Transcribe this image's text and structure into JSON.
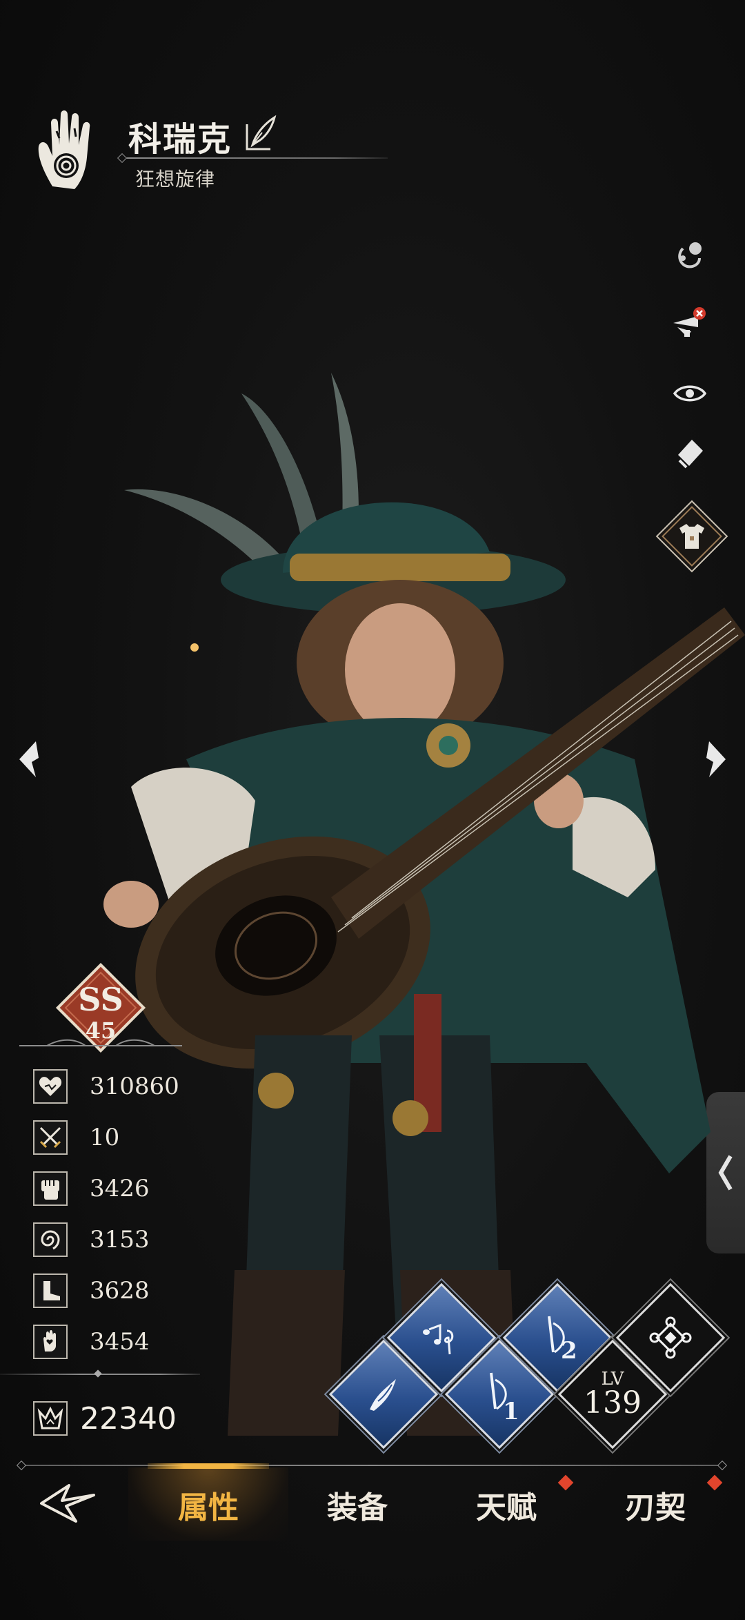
{
  "header": {
    "character_name": "科瑞克",
    "character_title": "狂想旋律",
    "class_icon": "open-hand-sigil-icon",
    "edit_icon": "quill-edit-icon"
  },
  "tools": [
    {
      "name": "pose-icon"
    },
    {
      "name": "hide-weapon-icon"
    },
    {
      "name": "eye-icon"
    },
    {
      "name": "card-icon"
    },
    {
      "name": "costume-shirt-icon"
    }
  ],
  "grade": {
    "rank": "SS",
    "level": "45"
  },
  "stats": [
    {
      "icon": "heart-hp-icon",
      "value": "310860"
    },
    {
      "icon": "crossed-swords-icon",
      "value": "10"
    },
    {
      "icon": "fist-attack-icon",
      "value": "3426"
    },
    {
      "icon": "vortex-icon",
      "value": "3153"
    },
    {
      "icon": "boot-speed-icon",
      "value": "3628"
    },
    {
      "icon": "hand-heart-icon",
      "value": "3454"
    }
  ],
  "power": {
    "icon": "crown-power-icon",
    "value": "22340"
  },
  "skills": {
    "level_label": "LV",
    "level_value": "139",
    "skill_1_num": "1",
    "skill_2_num": "2"
  },
  "nav": {
    "tabs": [
      "属性",
      "装备",
      "天赋",
      "刃契"
    ],
    "active_index": 0,
    "badges": [
      false,
      false,
      true,
      true
    ]
  },
  "colors": {
    "accent": "#f2b543",
    "skill_blue": "#2a4f8e",
    "grade_red": "#9a3a26",
    "badge_red": "#e2452d"
  }
}
